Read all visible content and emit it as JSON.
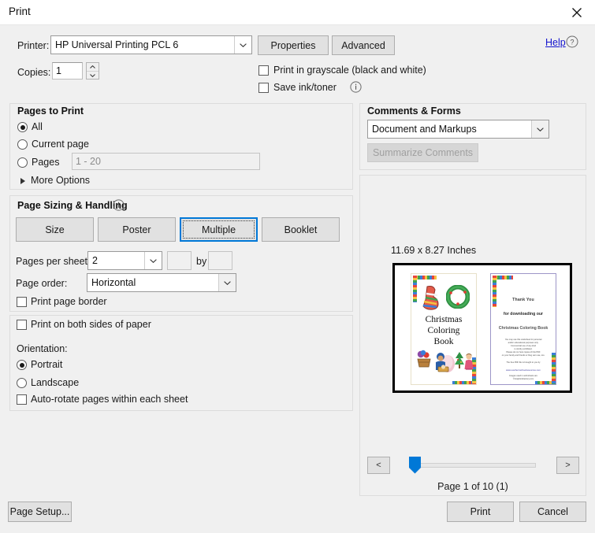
{
  "window": {
    "title": "Print",
    "close_icon": "close-icon"
  },
  "printer": {
    "label": "Printer:",
    "value": "HP Universal Printing PCL 6",
    "properties_label": "Properties",
    "advanced_label": "Advanced",
    "help_label": "Help",
    "help_icon": "question-mark-circle-icon"
  },
  "copies": {
    "label": "Copies:",
    "value": "1"
  },
  "options": {
    "grayscale_label": "Print in grayscale (black and white)",
    "grayscale_checked": false,
    "saveink_label": "Save ink/toner",
    "saveink_checked": false,
    "saveink_info_icon": "info-icon"
  },
  "pages_to_print": {
    "title": "Pages to Print",
    "all_label": "All",
    "current_label": "Current page",
    "pages_label": "Pages",
    "pages_placeholder": "1 - 20",
    "pages_value": "",
    "selected": "All",
    "more_options_label": "More Options",
    "more_options_icon": "chevron-right-icon"
  },
  "page_sizing": {
    "title": "Page Sizing & Handling",
    "info_icon": "info-icon",
    "modes": [
      "Size",
      "Poster",
      "Multiple",
      "Booklet"
    ],
    "selected_mode": "Multiple",
    "pages_per_sheet_label": "Pages per sheet:",
    "pages_per_sheet_value": "2",
    "custom_by_label": "by",
    "custom_x": "",
    "custom_y": "",
    "page_order_label": "Page order:",
    "page_order_value": "Horizontal",
    "print_page_border_label": "Print page border",
    "print_page_border_checked": false
  },
  "duplex": {
    "both_sides_label": "Print on both sides of paper",
    "both_sides_checked": false,
    "orientation_label": "Orientation:",
    "portrait_label": "Portrait",
    "landscape_label": "Landscape",
    "orientation_selected": "Portrait",
    "auto_rotate_label": "Auto-rotate pages within each sheet",
    "auto_rotate_checked": false
  },
  "comments_forms": {
    "title": "Comments & Forms",
    "value": "Document and Markups",
    "summarize_label": "Summarize Comments",
    "summarize_enabled": false
  },
  "preview": {
    "dimensions": "11.69 x 8.27 Inches",
    "page_indicator": "Page 1 of 10 (1)",
    "prev_label": "<",
    "next_label": ">",
    "left_page": {
      "title_line1": "Christmas",
      "title_line2": "Coloring",
      "title_line3": "Book"
    },
    "right_page": {
      "line1": "Thank You",
      "line2": "for downloading our",
      "line3": "Christmas Coloring Book",
      "body1": "You may use this worksheet for personal",
      "body2": "and/or educational purposes only.",
      "body3": "Commercial use of any kind",
      "body4": "is strictly prohibited.",
      "body5": "Please do not host copies of this PDF",
      "body6": "on your family and friends or blog own use, too.",
      "body7": "The free PDF file is brought to you by",
      "url": "www.southernschoolresources.com",
      "credit1": "Images used in worksheets are",
      "credit2": "©GraphicsFactory.com"
    }
  },
  "footer": {
    "page_setup_label": "Page Setup...",
    "print_label": "Print",
    "cancel_label": "Cancel"
  },
  "colors": {
    "accent": "#0078d7",
    "link": "#1313ce",
    "dialog_bg": "#f0f0f0"
  }
}
